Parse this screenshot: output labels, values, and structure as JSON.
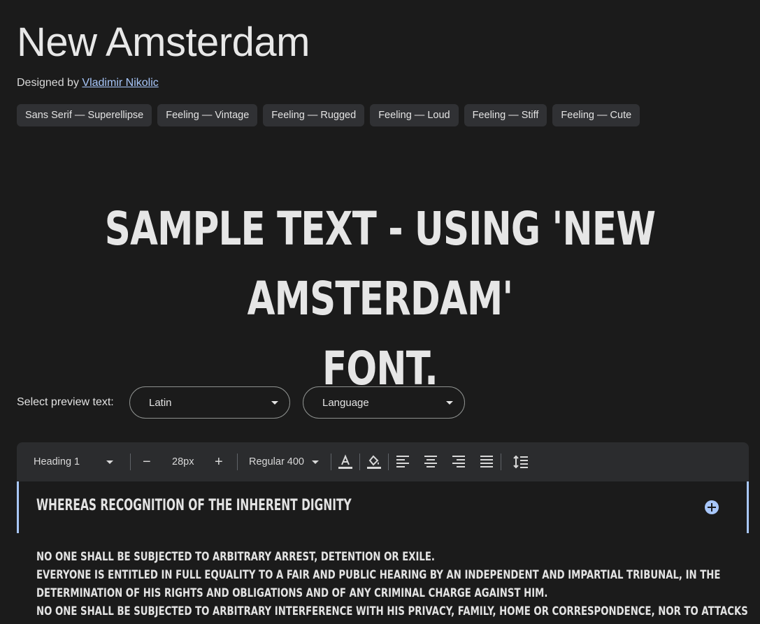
{
  "font": {
    "name": "New Amsterdam",
    "designed_by_label": "Designed by",
    "designer": "Vladimir Nikolic"
  },
  "tags": [
    "Sans Serif — Superellipse",
    "Feeling — Vintage",
    "Feeling — Rugged",
    "Feeling — Loud",
    "Feeling — Stiff",
    "Feeling — Cute"
  ],
  "sample": {
    "line1": "SAMPLE TEXT - USING 'NEW AMSTERDAM'",
    "line2": "FONT."
  },
  "preview": {
    "label": "Select preview text:",
    "script_value": "Latin",
    "language_value": "Language"
  },
  "toolbar": {
    "style": "Heading 1",
    "decrease_label": "−",
    "size": "28px",
    "increase_label": "+",
    "weight": "Regular 400"
  },
  "editor": {
    "heading": "WHEREAS RECOGNITION OF THE INHERENT DIGNITY",
    "paragraphs": [
      "NO ONE SHALL BE SUBJECTED TO ARBITRARY ARREST, DETENTION OR EXILE.",
      "EVERYONE IS ENTITLED IN FULL EQUALITY TO A FAIR AND PUBLIC HEARING BY AN INDEPENDENT AND IMPARTIAL TRIBUNAL, IN THE",
      "DETERMINATION OF HIS RIGHTS AND OBLIGATIONS AND OF ANY CRIMINAL CHARGE AGAINST HIM.",
      "NO ONE SHALL BE SUBJECTED TO ARBITRARY INTERFERENCE WITH HIS PRIVACY, FAMILY, HOME OR CORRESPONDENCE, NOR TO ATTACKS"
    ]
  },
  "colors": {
    "background": "#1b1b1b",
    "accent": "#a8c7fa",
    "chip": "#303134",
    "toolbar": "#2b2c2e"
  }
}
